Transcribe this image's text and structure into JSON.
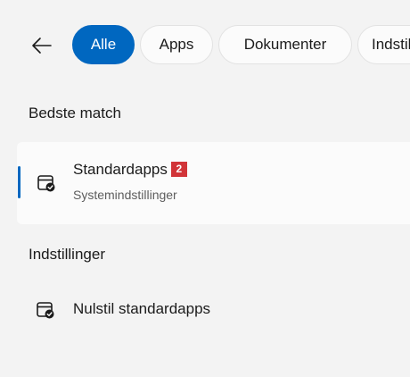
{
  "filters": {
    "back_icon": "arrow-left-icon",
    "items": [
      {
        "label": "Alle",
        "active": true
      },
      {
        "label": "Apps",
        "active": false
      },
      {
        "label": "Dokumenter",
        "active": false
      },
      {
        "label": "Indstillinger",
        "active": false
      }
    ]
  },
  "best_match": {
    "heading": "Bedste match",
    "title": "Standardapps",
    "badge": "2",
    "subtitle": "Systemindstillinger",
    "icon": "default-apps-icon"
  },
  "settings": {
    "heading": "Indstillinger",
    "items": [
      {
        "label": "Nulstil standardapps",
        "icon": "default-apps-icon"
      }
    ]
  },
  "colors": {
    "accent": "#0067c0",
    "badge": "#d13438",
    "background": "#f3f3f3"
  }
}
